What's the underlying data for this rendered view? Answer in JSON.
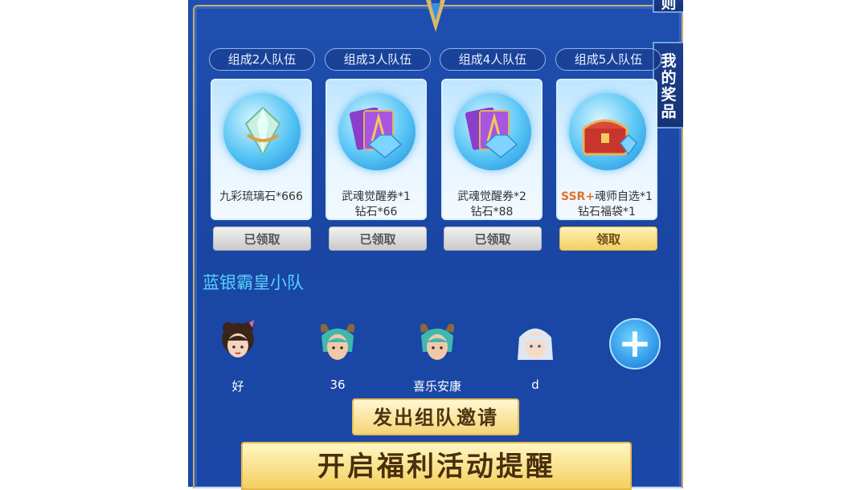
{
  "side_tabs": {
    "top_label": "则",
    "prize_chars": [
      "我",
      "的",
      "奖",
      "品"
    ]
  },
  "team_sizes": [
    "组成2人队伍",
    "组成3人队伍",
    "组成4人队伍",
    "组成5人队伍"
  ],
  "rewards": [
    {
      "icon": "crystal-icon",
      "line1_prefix": "",
      "line1": "九彩琉璃石*666",
      "line2": "",
      "status": "已领取"
    },
    {
      "icon": "ticket-diamond-icon",
      "line1_prefix": "",
      "line1": "武魂觉醒券*1",
      "line2": "钻石*66",
      "status": "已领取"
    },
    {
      "icon": "ticket-diamond-icon",
      "line1_prefix": "",
      "line1": "武魂觉醒券*2",
      "line2": "钻石*88",
      "status": "已领取"
    },
    {
      "icon": "treasure-chest-icon",
      "line1_prefix": "SSR+",
      "line1": "魂师自选*1",
      "line2": "钻石福袋*1",
      "status": "领取"
    }
  ],
  "team": {
    "name": "蓝银霸皇小队",
    "members": [
      {
        "name": "好",
        "avatar": "girl-avatar"
      },
      {
        "name": "36",
        "avatar": "horned-warrior-avatar"
      },
      {
        "name": "喜乐安康",
        "avatar": "horned-warrior-avatar"
      },
      {
        "name": "d",
        "avatar": "silver-hair-avatar"
      }
    ],
    "add_label": "+"
  },
  "buttons": {
    "invite": "发出组队邀请",
    "remind": "开启福利活动提醒"
  },
  "colors": {
    "panel": "#1f4fb0",
    "gold": "#f4cf5e",
    "team_name": "#56d2ff",
    "ssr": "#e6702a"
  }
}
